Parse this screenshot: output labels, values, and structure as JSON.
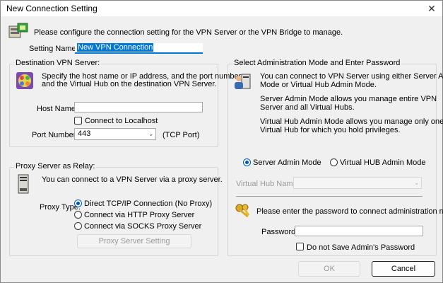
{
  "window": {
    "title": "New Connection Setting"
  },
  "intro": "Please configure the connection setting for the VPN Server or the VPN Bridge to manage.",
  "setting_name": {
    "label": "Setting Name:",
    "value": "New VPN Connection"
  },
  "destination": {
    "legend": "Destination VPN Server:",
    "desc1": "Specify the host name or IP address, and the port number",
    "desc2": "and the Virtual Hub on the destination VPN Server.",
    "host_label": "Host Name:",
    "host_value": "",
    "localhost_label": "Connect to Localhost",
    "port_label": "Port Number:",
    "port_value": "443",
    "port_hint": "(TCP Port)"
  },
  "proxy": {
    "legend": "Proxy Server as Relay:",
    "desc": "You can connect to a VPN Server via a proxy server.",
    "type_label": "Proxy Type:",
    "options": [
      "Direct TCP/IP Connection (No Proxy)",
      "Connect via HTTP Proxy Server",
      "Connect via SOCKS Proxy Server"
    ],
    "setting_button": "Proxy Server Setting"
  },
  "admin": {
    "legend": "Select Administration Mode and Enter Password",
    "desc1a": "You can connect to VPN Server using either Server Admin",
    "desc1b": "Mode or Virtual Hub Admin Mode.",
    "desc2a": "Server Admin Mode allows you manage entire VPN",
    "desc2b": "Server and all Virtual Hubs.",
    "desc3a": "Virtual Hub Admin Mode allows you manage only one",
    "desc3b": "Virtual Hub for which you hold privileges.",
    "mode_server": "Server Admin Mode",
    "mode_hub": "Virtual HUB Admin Mode",
    "hub_name_label": "Virtual Hub Name:",
    "password_prompt": "Please enter the password to connect administration mode.",
    "password_label": "Password:",
    "no_save_label": "Do not Save Admin's Password"
  },
  "buttons": {
    "ok": "OK",
    "cancel": "Cancel"
  },
  "colors": {
    "accent": "#0057b8",
    "selection": "#0078d7"
  }
}
